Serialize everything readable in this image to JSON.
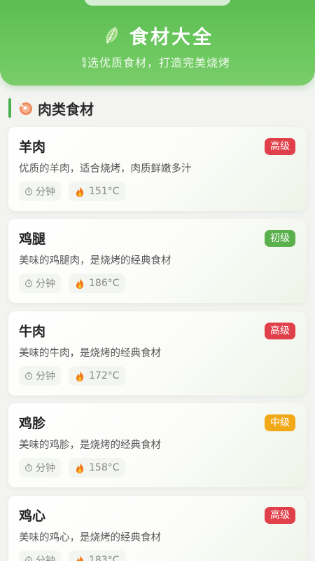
{
  "header": {
    "title": "食材大全",
    "subtitle": "请选优质食材，打造完美烧烤",
    "icon": "leafy-vegetable-icon",
    "color": "#5cbd52"
  },
  "section": {
    "title": "肉类食材",
    "icon": "meat-icon",
    "accent": "#4caf50"
  },
  "items": [
    {
      "name": "羊肉",
      "desc": "优质的羊肉，适合烧烤，肉质鲜嫩多汁",
      "level": "高级",
      "level_color": "#e0404a",
      "time": "分钟",
      "temp": "151°C"
    },
    {
      "name": "鸡腿",
      "desc": "美味的鸡腿肉，是烧烤的经典食材",
      "level": "初级",
      "level_color": "#5bb04e",
      "time": "分钟",
      "temp": "186°C"
    },
    {
      "name": "牛肉",
      "desc": "美味的牛肉，是烧烤的经典食材",
      "level": "高级",
      "level_color": "#e0404a",
      "time": "分钟",
      "temp": "172°C"
    },
    {
      "name": "鸡胗",
      "desc": "美味的鸡胗，是烧烤的经典食材",
      "level": "中级",
      "level_color": "#f2a918",
      "time": "分钟",
      "temp": "158°C"
    },
    {
      "name": "鸡心",
      "desc": "美味的鸡心，是烧烤的经典食材",
      "level": "高级",
      "level_color": "#e0404a",
      "time": "分钟",
      "temp": "183°C"
    }
  ]
}
